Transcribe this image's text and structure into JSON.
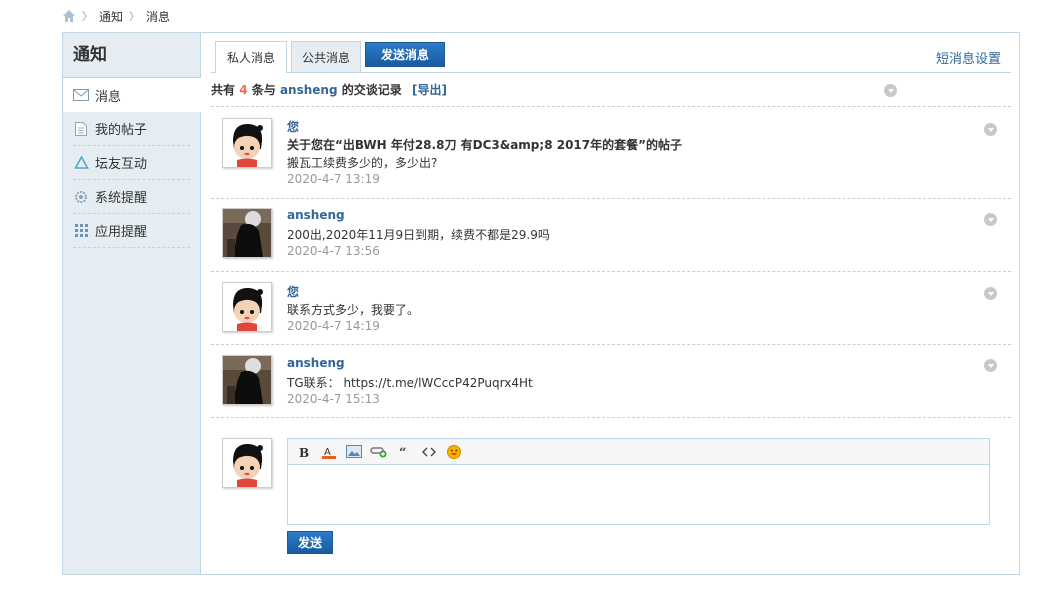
{
  "breadcrumb": {
    "items": [
      "通知",
      "消息"
    ]
  },
  "sidebar": {
    "title": "通知",
    "items": [
      {
        "label": "消息",
        "icon": "envelope-icon",
        "active": true
      },
      {
        "label": "我的帖子",
        "icon": "document-icon"
      },
      {
        "label": "坛友互动",
        "icon": "recycle-icon"
      },
      {
        "label": "系统提醒",
        "icon": "gear-icon"
      },
      {
        "label": "应用提醒",
        "icon": "grid-icon"
      }
    ]
  },
  "tabs": {
    "private": "私人消息",
    "public": "公共消息",
    "send": "发送消息",
    "settings": "短消息设置"
  },
  "summary": {
    "prefix": "共有",
    "count": "4",
    "middle": "条与",
    "user": "ansheng",
    "suffix": "的交谈记录",
    "export": "[导出]"
  },
  "messages": [
    {
      "author": "您",
      "avatar": "cartoon-avatar",
      "lines": [
        "关于您在“出BWH 年付28.8刀 有DC3&amp;8 2017年的套餐”的帖子",
        "搬瓦工续费多少的，多少出?"
      ],
      "time": "2020-4-7 13:19"
    },
    {
      "author": "ansheng",
      "avatar": "photo-avatar",
      "lines": [
        "200出,2020年11月9日到期，续费不都是29.9吗"
      ],
      "time": "2020-4-7 13:56"
    },
    {
      "author": "您",
      "avatar": "cartoon-avatar",
      "lines": [
        "联系方式多少，我要了。"
      ],
      "time": "2020-4-7 14:19"
    },
    {
      "author": "ansheng",
      "avatar": "photo-avatar",
      "lines": [
        "TG联系： https://t.me/lWCccP42Puqrx4Ht"
      ],
      "time": "2020-4-7 15:13"
    }
  ],
  "reply": {
    "send_label": "发送",
    "text": ""
  },
  "colors": {
    "link": "#336699",
    "border": "#c2d5e3",
    "sidebar_bg": "#e5edf2",
    "count": "#f26c4f",
    "button": "#1a5a9f"
  }
}
